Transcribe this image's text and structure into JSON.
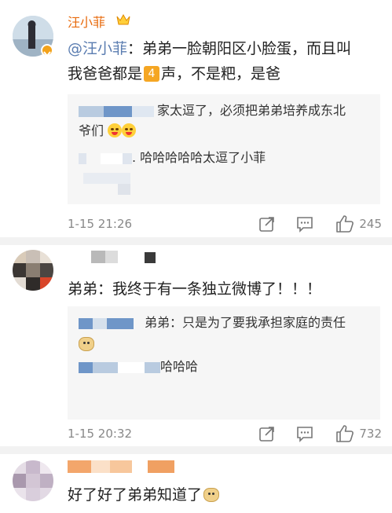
{
  "comment1": {
    "username": "汪小菲",
    "mention": "@汪小菲",
    "text_line1_rest": "：弟弟一脸朝阳区小脸蛋，而且叫",
    "text_line2_a": "我爸爸都是",
    "tone_badge": "4",
    "text_line2_b": "声，不是粑，是爸",
    "reply1_line1": "家太逗了，必须把弟弟培养成东北",
    "reply1_line2": "爷们",
    "reply2_text": ". 哈哈哈哈哈太逗了小菲",
    "time": "1-15 21:26",
    "like_count": "245"
  },
  "comment2": {
    "text": "弟弟：我终于有一条独立微博了！！！",
    "reply1_line1": "弟弟：只是为了要我承担家庭的责任",
    "reply2_text": "哈哈哈",
    "time": "1-15 20:32",
    "like_count": "732"
  },
  "comment3": {
    "text": "好了好了弟弟知道了"
  },
  "icons": {
    "verified": "verified-badge-icon",
    "crown": "crown-icon",
    "forward": "forward-icon",
    "comment": "comment-icon",
    "like": "like-icon",
    "emoji": "grin-emoji-icon",
    "doge": "doge-emoji-icon"
  },
  "colors": {
    "username": "#e86a0c",
    "link": "#5b7db1",
    "badge": "#f5a623",
    "reply_bg": "#f6f6f6",
    "meta": "#888888"
  }
}
